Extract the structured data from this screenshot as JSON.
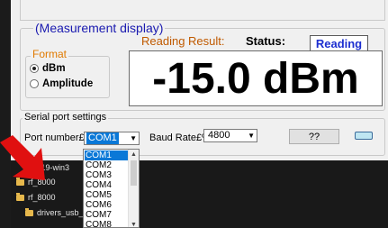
{
  "measurement": {
    "group_title": "(Measurement display)",
    "reading_label": "Reading Result:",
    "status_label": "Status:",
    "status_value": "Reading",
    "value": "-15.0  dBm",
    "format": {
      "title": "Format",
      "options": [
        {
          "label": "dBm",
          "selected": true
        },
        {
          "label": "Amplitude",
          "selected": false
        }
      ]
    }
  },
  "serial": {
    "group_title": "Serial port settings",
    "port_label": "Port number£º",
    "port_value": "COM1",
    "baud_label": "Baud Rate£º",
    "baud_value": "4800",
    "query_button": "??",
    "port_options": [
      "COM1",
      "COM2",
      "COM3",
      "COM4",
      "COM5",
      "COM6",
      "COM7",
      "COM8"
    ]
  },
  "explorer": {
    "items": [
      "0.19-win3",
      "rf_8000",
      "rf_8000",
      "drivers_usb_C"
    ]
  },
  "colors": {
    "accent_blue": "#1a1ab0",
    "accent_orange": "#e07a00",
    "selection": "#0a78d7",
    "annotation_arrow": "#e01010"
  }
}
